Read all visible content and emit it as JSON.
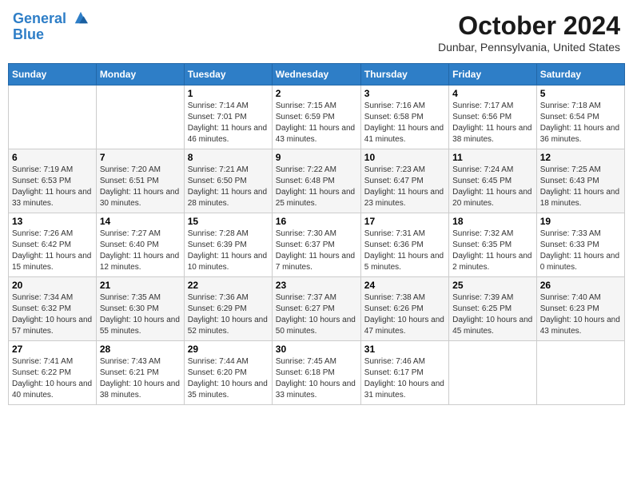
{
  "header": {
    "logo_line1": "General",
    "logo_line2": "Blue",
    "month": "October 2024",
    "location": "Dunbar, Pennsylvania, United States"
  },
  "weekdays": [
    "Sunday",
    "Monday",
    "Tuesday",
    "Wednesday",
    "Thursday",
    "Friday",
    "Saturday"
  ],
  "weeks": [
    [
      {
        "day": "",
        "sunrise": "",
        "sunset": "",
        "daylight": ""
      },
      {
        "day": "",
        "sunrise": "",
        "sunset": "",
        "daylight": ""
      },
      {
        "day": "1",
        "sunrise": "Sunrise: 7:14 AM",
        "sunset": "Sunset: 7:01 PM",
        "daylight": "Daylight: 11 hours and 46 minutes."
      },
      {
        "day": "2",
        "sunrise": "Sunrise: 7:15 AM",
        "sunset": "Sunset: 6:59 PM",
        "daylight": "Daylight: 11 hours and 43 minutes."
      },
      {
        "day": "3",
        "sunrise": "Sunrise: 7:16 AM",
        "sunset": "Sunset: 6:58 PM",
        "daylight": "Daylight: 11 hours and 41 minutes."
      },
      {
        "day": "4",
        "sunrise": "Sunrise: 7:17 AM",
        "sunset": "Sunset: 6:56 PM",
        "daylight": "Daylight: 11 hours and 38 minutes."
      },
      {
        "day": "5",
        "sunrise": "Sunrise: 7:18 AM",
        "sunset": "Sunset: 6:54 PM",
        "daylight": "Daylight: 11 hours and 36 minutes."
      }
    ],
    [
      {
        "day": "6",
        "sunrise": "Sunrise: 7:19 AM",
        "sunset": "Sunset: 6:53 PM",
        "daylight": "Daylight: 11 hours and 33 minutes."
      },
      {
        "day": "7",
        "sunrise": "Sunrise: 7:20 AM",
        "sunset": "Sunset: 6:51 PM",
        "daylight": "Daylight: 11 hours and 30 minutes."
      },
      {
        "day": "8",
        "sunrise": "Sunrise: 7:21 AM",
        "sunset": "Sunset: 6:50 PM",
        "daylight": "Daylight: 11 hours and 28 minutes."
      },
      {
        "day": "9",
        "sunrise": "Sunrise: 7:22 AM",
        "sunset": "Sunset: 6:48 PM",
        "daylight": "Daylight: 11 hours and 25 minutes."
      },
      {
        "day": "10",
        "sunrise": "Sunrise: 7:23 AM",
        "sunset": "Sunset: 6:47 PM",
        "daylight": "Daylight: 11 hours and 23 minutes."
      },
      {
        "day": "11",
        "sunrise": "Sunrise: 7:24 AM",
        "sunset": "Sunset: 6:45 PM",
        "daylight": "Daylight: 11 hours and 20 minutes."
      },
      {
        "day": "12",
        "sunrise": "Sunrise: 7:25 AM",
        "sunset": "Sunset: 6:43 PM",
        "daylight": "Daylight: 11 hours and 18 minutes."
      }
    ],
    [
      {
        "day": "13",
        "sunrise": "Sunrise: 7:26 AM",
        "sunset": "Sunset: 6:42 PM",
        "daylight": "Daylight: 11 hours and 15 minutes."
      },
      {
        "day": "14",
        "sunrise": "Sunrise: 7:27 AM",
        "sunset": "Sunset: 6:40 PM",
        "daylight": "Daylight: 11 hours and 12 minutes."
      },
      {
        "day": "15",
        "sunrise": "Sunrise: 7:28 AM",
        "sunset": "Sunset: 6:39 PM",
        "daylight": "Daylight: 11 hours and 10 minutes."
      },
      {
        "day": "16",
        "sunrise": "Sunrise: 7:30 AM",
        "sunset": "Sunset: 6:37 PM",
        "daylight": "Daylight: 11 hours and 7 minutes."
      },
      {
        "day": "17",
        "sunrise": "Sunrise: 7:31 AM",
        "sunset": "Sunset: 6:36 PM",
        "daylight": "Daylight: 11 hours and 5 minutes."
      },
      {
        "day": "18",
        "sunrise": "Sunrise: 7:32 AM",
        "sunset": "Sunset: 6:35 PM",
        "daylight": "Daylight: 11 hours and 2 minutes."
      },
      {
        "day": "19",
        "sunrise": "Sunrise: 7:33 AM",
        "sunset": "Sunset: 6:33 PM",
        "daylight": "Daylight: 11 hours and 0 minutes."
      }
    ],
    [
      {
        "day": "20",
        "sunrise": "Sunrise: 7:34 AM",
        "sunset": "Sunset: 6:32 PM",
        "daylight": "Daylight: 10 hours and 57 minutes."
      },
      {
        "day": "21",
        "sunrise": "Sunrise: 7:35 AM",
        "sunset": "Sunset: 6:30 PM",
        "daylight": "Daylight: 10 hours and 55 minutes."
      },
      {
        "day": "22",
        "sunrise": "Sunrise: 7:36 AM",
        "sunset": "Sunset: 6:29 PM",
        "daylight": "Daylight: 10 hours and 52 minutes."
      },
      {
        "day": "23",
        "sunrise": "Sunrise: 7:37 AM",
        "sunset": "Sunset: 6:27 PM",
        "daylight": "Daylight: 10 hours and 50 minutes."
      },
      {
        "day": "24",
        "sunrise": "Sunrise: 7:38 AM",
        "sunset": "Sunset: 6:26 PM",
        "daylight": "Daylight: 10 hours and 47 minutes."
      },
      {
        "day": "25",
        "sunrise": "Sunrise: 7:39 AM",
        "sunset": "Sunset: 6:25 PM",
        "daylight": "Daylight: 10 hours and 45 minutes."
      },
      {
        "day": "26",
        "sunrise": "Sunrise: 7:40 AM",
        "sunset": "Sunset: 6:23 PM",
        "daylight": "Daylight: 10 hours and 43 minutes."
      }
    ],
    [
      {
        "day": "27",
        "sunrise": "Sunrise: 7:41 AM",
        "sunset": "Sunset: 6:22 PM",
        "daylight": "Daylight: 10 hours and 40 minutes."
      },
      {
        "day": "28",
        "sunrise": "Sunrise: 7:43 AM",
        "sunset": "Sunset: 6:21 PM",
        "daylight": "Daylight: 10 hours and 38 minutes."
      },
      {
        "day": "29",
        "sunrise": "Sunrise: 7:44 AM",
        "sunset": "Sunset: 6:20 PM",
        "daylight": "Daylight: 10 hours and 35 minutes."
      },
      {
        "day": "30",
        "sunrise": "Sunrise: 7:45 AM",
        "sunset": "Sunset: 6:18 PM",
        "daylight": "Daylight: 10 hours and 33 minutes."
      },
      {
        "day": "31",
        "sunrise": "Sunrise: 7:46 AM",
        "sunset": "Sunset: 6:17 PM",
        "daylight": "Daylight: 10 hours and 31 minutes."
      },
      {
        "day": "",
        "sunrise": "",
        "sunset": "",
        "daylight": ""
      },
      {
        "day": "",
        "sunrise": "",
        "sunset": "",
        "daylight": ""
      }
    ]
  ]
}
